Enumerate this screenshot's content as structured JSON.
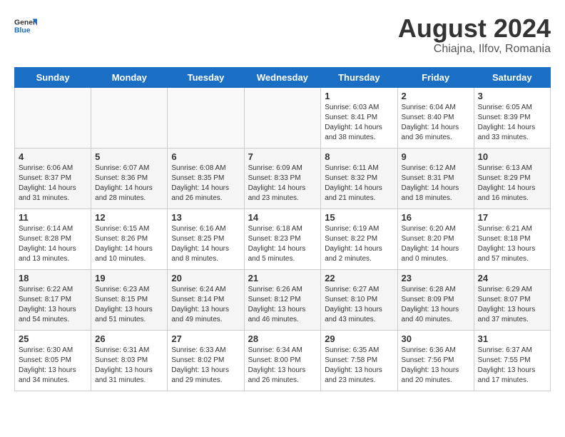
{
  "logo": {
    "general": "General",
    "blue": "Blue"
  },
  "title": {
    "month_year": "August 2024",
    "location": "Chiajna, Ilfov, Romania"
  },
  "headers": [
    "Sunday",
    "Monday",
    "Tuesday",
    "Wednesday",
    "Thursday",
    "Friday",
    "Saturday"
  ],
  "weeks": [
    [
      {
        "day": "",
        "info": ""
      },
      {
        "day": "",
        "info": ""
      },
      {
        "day": "",
        "info": ""
      },
      {
        "day": "",
        "info": ""
      },
      {
        "day": "1",
        "info": "Sunrise: 6:03 AM\nSunset: 8:41 PM\nDaylight: 14 hours\nand 38 minutes."
      },
      {
        "day": "2",
        "info": "Sunrise: 6:04 AM\nSunset: 8:40 PM\nDaylight: 14 hours\nand 36 minutes."
      },
      {
        "day": "3",
        "info": "Sunrise: 6:05 AM\nSunset: 8:39 PM\nDaylight: 14 hours\nand 33 minutes."
      }
    ],
    [
      {
        "day": "4",
        "info": "Sunrise: 6:06 AM\nSunset: 8:37 PM\nDaylight: 14 hours\nand 31 minutes."
      },
      {
        "day": "5",
        "info": "Sunrise: 6:07 AM\nSunset: 8:36 PM\nDaylight: 14 hours\nand 28 minutes."
      },
      {
        "day": "6",
        "info": "Sunrise: 6:08 AM\nSunset: 8:35 PM\nDaylight: 14 hours\nand 26 minutes."
      },
      {
        "day": "7",
        "info": "Sunrise: 6:09 AM\nSunset: 8:33 PM\nDaylight: 14 hours\nand 23 minutes."
      },
      {
        "day": "8",
        "info": "Sunrise: 6:11 AM\nSunset: 8:32 PM\nDaylight: 14 hours\nand 21 minutes."
      },
      {
        "day": "9",
        "info": "Sunrise: 6:12 AM\nSunset: 8:31 PM\nDaylight: 14 hours\nand 18 minutes."
      },
      {
        "day": "10",
        "info": "Sunrise: 6:13 AM\nSunset: 8:29 PM\nDaylight: 14 hours\nand 16 minutes."
      }
    ],
    [
      {
        "day": "11",
        "info": "Sunrise: 6:14 AM\nSunset: 8:28 PM\nDaylight: 14 hours\nand 13 minutes."
      },
      {
        "day": "12",
        "info": "Sunrise: 6:15 AM\nSunset: 8:26 PM\nDaylight: 14 hours\nand 10 minutes."
      },
      {
        "day": "13",
        "info": "Sunrise: 6:16 AM\nSunset: 8:25 PM\nDaylight: 14 hours\nand 8 minutes."
      },
      {
        "day": "14",
        "info": "Sunrise: 6:18 AM\nSunset: 8:23 PM\nDaylight: 14 hours\nand 5 minutes."
      },
      {
        "day": "15",
        "info": "Sunrise: 6:19 AM\nSunset: 8:22 PM\nDaylight: 14 hours\nand 2 minutes."
      },
      {
        "day": "16",
        "info": "Sunrise: 6:20 AM\nSunset: 8:20 PM\nDaylight: 14 hours\nand 0 minutes."
      },
      {
        "day": "17",
        "info": "Sunrise: 6:21 AM\nSunset: 8:18 PM\nDaylight: 13 hours\nand 57 minutes."
      }
    ],
    [
      {
        "day": "18",
        "info": "Sunrise: 6:22 AM\nSunset: 8:17 PM\nDaylight: 13 hours\nand 54 minutes."
      },
      {
        "day": "19",
        "info": "Sunrise: 6:23 AM\nSunset: 8:15 PM\nDaylight: 13 hours\nand 51 minutes."
      },
      {
        "day": "20",
        "info": "Sunrise: 6:24 AM\nSunset: 8:14 PM\nDaylight: 13 hours\nand 49 minutes."
      },
      {
        "day": "21",
        "info": "Sunrise: 6:26 AM\nSunset: 8:12 PM\nDaylight: 13 hours\nand 46 minutes."
      },
      {
        "day": "22",
        "info": "Sunrise: 6:27 AM\nSunset: 8:10 PM\nDaylight: 13 hours\nand 43 minutes."
      },
      {
        "day": "23",
        "info": "Sunrise: 6:28 AM\nSunset: 8:09 PM\nDaylight: 13 hours\nand 40 minutes."
      },
      {
        "day": "24",
        "info": "Sunrise: 6:29 AM\nSunset: 8:07 PM\nDaylight: 13 hours\nand 37 minutes."
      }
    ],
    [
      {
        "day": "25",
        "info": "Sunrise: 6:30 AM\nSunset: 8:05 PM\nDaylight: 13 hours\nand 34 minutes."
      },
      {
        "day": "26",
        "info": "Sunrise: 6:31 AM\nSunset: 8:03 PM\nDaylight: 13 hours\nand 31 minutes."
      },
      {
        "day": "27",
        "info": "Sunrise: 6:33 AM\nSunset: 8:02 PM\nDaylight: 13 hours\nand 29 minutes."
      },
      {
        "day": "28",
        "info": "Sunrise: 6:34 AM\nSunset: 8:00 PM\nDaylight: 13 hours\nand 26 minutes."
      },
      {
        "day": "29",
        "info": "Sunrise: 6:35 AM\nSunset: 7:58 PM\nDaylight: 13 hours\nand 23 minutes."
      },
      {
        "day": "30",
        "info": "Sunrise: 6:36 AM\nSunset: 7:56 PM\nDaylight: 13 hours\nand 20 minutes."
      },
      {
        "day": "31",
        "info": "Sunrise: 6:37 AM\nSunset: 7:55 PM\nDaylight: 13 hours\nand 17 minutes."
      }
    ]
  ]
}
